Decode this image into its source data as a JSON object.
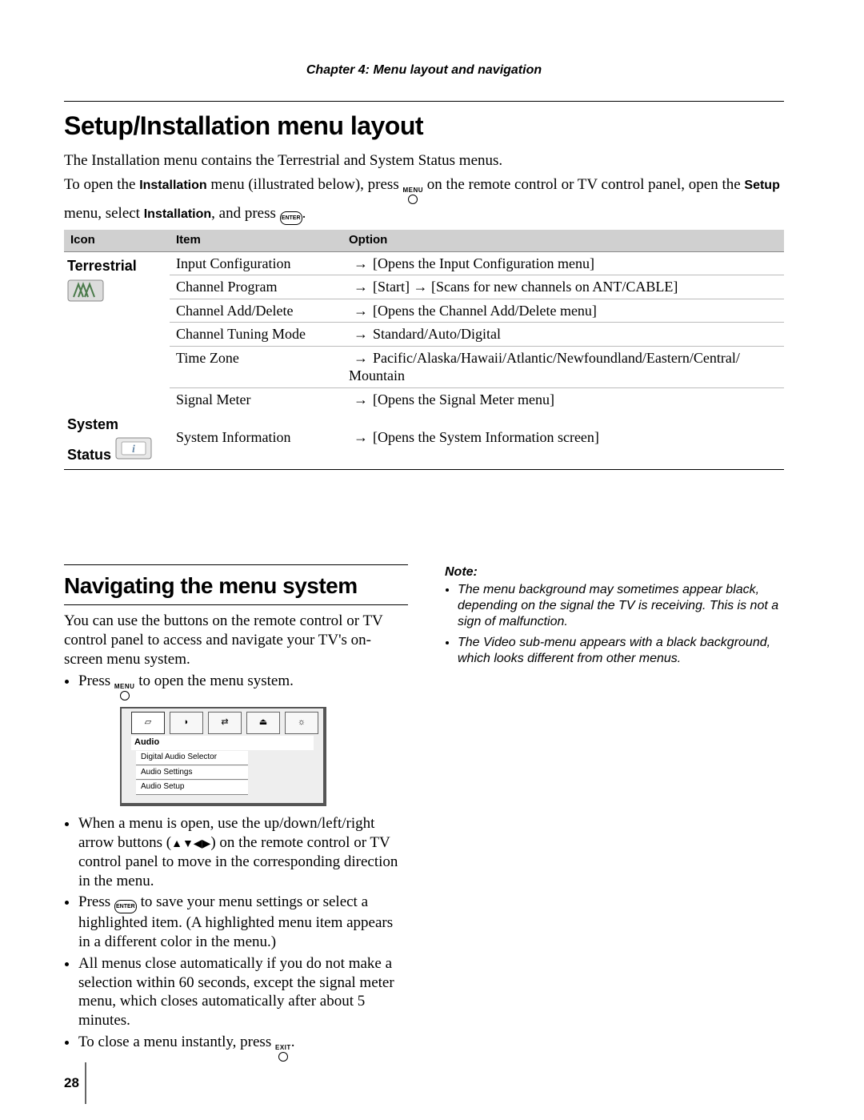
{
  "chapter": "Chapter 4: Menu layout and navigation",
  "heading1": "Setup/Installation menu layout",
  "intro1": "The Installation menu contains the Terrestrial and System Status menus.",
  "intro2_pre": "To open the ",
  "intro2_b1": "Installation",
  "intro2_mid": " menu (illustrated below), press ",
  "intro2_after_menu": " on the remote control or TV control panel, open the ",
  "intro2_b2": "Setup",
  "intro2_mid2": " menu, select ",
  "intro2_b3": "Installation",
  "intro2_mid3": ", and press ",
  "intro2_end": ".",
  "btn_menu": "MENU",
  "btn_exit": "EXIT",
  "btn_enter": "ENTER",
  "th": {
    "icon": "Icon",
    "item": "Item",
    "option": "Option"
  },
  "groups": {
    "terrestrial": {
      "label": "Terrestrial",
      "rows": [
        {
          "item": "Input Configuration",
          "opt": "[Opens the Input Configuration menu]"
        },
        {
          "item": "Channel Program",
          "opt": "[Start] → [Scans for new channels on ANT/CABLE]"
        },
        {
          "item": "Channel Add/Delete",
          "opt": "[Opens the Channel Add/Delete menu]"
        },
        {
          "item": "Channel Tuning Mode",
          "opt": "Standard/Auto/Digital"
        },
        {
          "item": "Time Zone",
          "opt": "Pacific/Alaska/Hawaii/Atlantic/Newfoundland/Eastern/Central/ Mountain"
        },
        {
          "item": "Signal Meter",
          "opt": "[Opens the Signal Meter menu]"
        }
      ]
    },
    "system": {
      "label": "System Status",
      "rows": [
        {
          "item": "System Information",
          "opt": "[Opens the System Information screen]"
        }
      ]
    }
  },
  "heading2": "Navigating the menu system",
  "nav_intro": "You can use the buttons on the remote control or TV control panel to access and navigate your TV's on-screen menu system.",
  "bul1_pre": "Press ",
  "bul1_post": " to open the menu system.",
  "osd": {
    "title": "Audio",
    "items": [
      "Digital Audio Selector",
      "Audio Settings",
      "Audio Setup"
    ]
  },
  "bul2_pre": "When a menu is open, use the up/down/left/right arrow buttons (",
  "bul2_arrows": "▲▼◀▶",
  "bul2_post": ") on the remote control or TV control panel to move in the corresponding direction in the menu.",
  "bul3_pre": "Press ",
  "bul3_post": " to save your menu settings or select a highlighted item. (A highlighted menu item appears in a different color in the menu.)",
  "bul4": "All menus close automatically if you do not make a selection within 60 seconds, except the signal meter menu, which closes automatically after about 5 minutes.",
  "bul5_pre": "To close a menu instantly, press ",
  "bul5_post": ".",
  "note_head": "Note:",
  "note1": "The menu background may sometimes appear black, depending on the signal the TV is receiving. This is not a sign of malfunction.",
  "note2": "The Video sub-menu appears with a black background, which looks different from other menus.",
  "pagenum": "28"
}
